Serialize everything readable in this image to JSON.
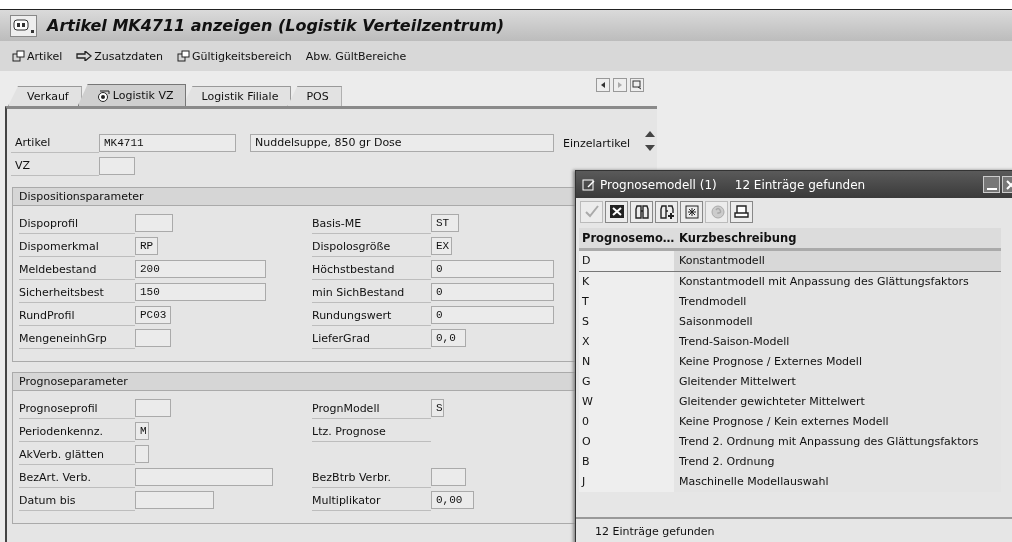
{
  "window": {
    "title": "Artikel MK4711 anzeigen (Logistik Verteilzentrum)"
  },
  "toolbar": [
    {
      "label": "Artikel",
      "kind": "copy"
    },
    {
      "label": "Zusatzdaten",
      "kind": "arrow"
    },
    {
      "label": "Gültigkeitsbereich",
      "kind": "copy"
    },
    {
      "label": "Abw. GültBereiche",
      "kind": "plain"
    }
  ],
  "tabs": [
    {
      "label": "Verkauf",
      "selected": false,
      "kind": "plain"
    },
    {
      "label": "Logistik VZ",
      "selected": true,
      "kind": "icon"
    },
    {
      "label": "Logistik Filiale",
      "selected": false,
      "kind": "plain"
    },
    {
      "label": "POS",
      "selected": false,
      "kind": "plain"
    }
  ],
  "header": {
    "article": {
      "label": "Artikel",
      "value": "MK4711"
    },
    "description": "Nuddelsuppe, 850 gr Dose",
    "article_type": "Einzelartikel",
    "vz": {
      "label": "VZ"
    }
  },
  "groups": [
    {
      "title": "Dispositionsparameter",
      "rows": [
        {
          "left": {
            "label": "Dispoprofil"
          },
          "right": {
            "label": "Basis-ME",
            "value": "ST"
          }
        },
        {
          "left": {
            "label": "Dispomerkmal",
            "value": "RP"
          },
          "right": {
            "label": "Dispolosgröße",
            "value": "EX"
          }
        },
        {
          "left": {
            "label": "Meldebestand",
            "value": "200"
          },
          "right": {
            "label": "Höchstbestand",
            "value": "0"
          }
        },
        {
          "left": {
            "label": "Sicherheitsbest",
            "value": "150"
          },
          "right": {
            "label": "min SichBestand",
            "value": "0"
          }
        },
        {
          "left": {
            "label": "RundProfil",
            "value": "PC03"
          },
          "right": {
            "label": "Rundungswert",
            "value": "0"
          }
        },
        {
          "left": {
            "label": "MengeneinhGrp"
          },
          "right": {
            "label": "LieferGrad",
            "value": "0,0"
          }
        }
      ]
    },
    {
      "title": "Prognoseparameter",
      "rows": [
        {
          "left": {
            "label": "Prognoseprofil"
          },
          "right": {
            "label": "PrognModell",
            "value": "S"
          }
        },
        {
          "left": {
            "label": "Periodenkennz.",
            "value": "M"
          },
          "right": {
            "label": "Ltz. Prognose"
          }
        },
        {
          "left": {
            "label": "AkVerb. glätten"
          }
        },
        {
          "left": {
            "label": "BezArt. Verb."
          },
          "right": {
            "label": "BezBtrb Verbr."
          }
        },
        {
          "left": {
            "label": "Datum bis"
          },
          "right": {
            "label": "Multiplikator",
            "value": "0,00"
          }
        }
      ]
    }
  ],
  "popup": {
    "title": "Prognosemodell (1)",
    "count": "12 Einträge gefunden",
    "tools": [
      {
        "kind": "check",
        "disabled": true
      },
      {
        "kind": "cancel",
        "disabled": false
      },
      {
        "kind": "find",
        "disabled": false
      },
      {
        "kind": "find-next",
        "disabled": false
      },
      {
        "kind": "sparkle",
        "disabled": false
      },
      {
        "kind": "help",
        "disabled": true
      },
      {
        "kind": "print",
        "disabled": false
      }
    ],
    "columns": [
      "Prognosemo…",
      "Kurzbeschreibung"
    ],
    "rows": [
      {
        "code": "D",
        "text": "Konstantmodell",
        "selected": true
      },
      {
        "code": "K",
        "text": "Konstantmodell mit Anpassung des Glättungsfaktors",
        "selected": false
      },
      {
        "code": "T",
        "text": "Trendmodell",
        "selected": false
      },
      {
        "code": "S",
        "text": "Saisonmodell",
        "selected": false
      },
      {
        "code": "X",
        "text": "Trend-Saison-Modell",
        "selected": false
      },
      {
        "code": "N",
        "text": "Keine Prognose / Externes Modell",
        "selected": false
      },
      {
        "code": "G",
        "text": "Gleitender Mittelwert",
        "selected": false
      },
      {
        "code": "W",
        "text": "Gleitender gewichteter Mittelwert",
        "selected": false
      },
      {
        "code": "0",
        "text": "Keine Prognose / Kein externes Modell",
        "selected": false
      },
      {
        "code": "O",
        "text": "Trend 2. Ordnung mit Anpassung des Glättungsfaktors",
        "selected": false
      },
      {
        "code": "B",
        "text": "Trend 2. Ordnung",
        "selected": false
      },
      {
        "code": "J",
        "text": "Maschinelle Modellauswahl",
        "selected": false
      }
    ],
    "status": "12 Einträge gefunden"
  }
}
